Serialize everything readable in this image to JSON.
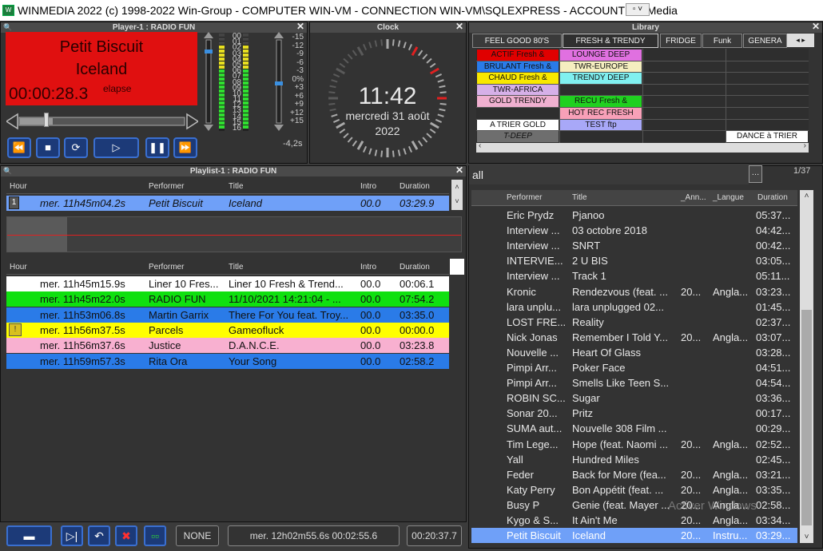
{
  "window": {
    "title": "WINMEDIA 2022 (c) 1998-2022 Win-Group - COMPUTER WIN-VM - CONNECTION WIN-VM\\SQLEXPRESS - ACCOUNT WinMedia"
  },
  "player": {
    "title": "Player-1 : RADIO FUN",
    "line1": "Petit Biscuit",
    "line2": "Iceland",
    "time": "00:00:28.3",
    "elapsed_label": "elapse",
    "scale_left": [
      "00",
      "01",
      "02",
      "03",
      "04",
      "05",
      "06",
      "07",
      "08",
      "09",
      "10",
      "11",
      "12",
      "13",
      "14",
      "15",
      "16"
    ],
    "scale_right": [
      "-15",
      "-12",
      "-9",
      "-6",
      "-3",
      "0%",
      "+3",
      "+6",
      "+9",
      "+12",
      "+15"
    ],
    "gain": "-4,2s",
    "progress": 0.2
  },
  "clock": {
    "title": "Clock",
    "time": "11:42",
    "date": "mercredi 31 août",
    "year": "2022"
  },
  "library": {
    "title": "Library",
    "tabs": [
      "FEEL GOOD 80'S",
      "FRESH & TRENDY",
      "FRIDGE",
      "Funk",
      "GENERA"
    ],
    "cells": [
      {
        "text": "ACTIF Fresh &",
        "color": "#e00000"
      },
      {
        "text": "LOUNGE DEEP",
        "color": "#e070e0"
      },
      {
        "text": "BRULANT Fresh &",
        "color": "#2a7be8"
      },
      {
        "text": "TWR-EUROPE",
        "color": "#f5eec0"
      },
      {
        "text": "CHAUD Fresh &",
        "color": "#f8e800"
      },
      {
        "text": "TRENDY DEEP",
        "color": "#80f0f0"
      },
      {
        "text": "TWR-AFRICA",
        "color": "#d6b0e8"
      },
      {
        "text": "GOLD TRENDY",
        "color": "#f0b0d0"
      },
      {
        "text": "RECU Fresh &",
        "color": "#20d020"
      },
      {
        "text": "HOT REC  FRESH",
        "color": "#f8a0b8"
      },
      {
        "text": "A TRIER GOLD",
        "color": "#ffffff"
      },
      {
        "text": "TEST ftp",
        "color": "#a8a8f8"
      },
      {
        "text": "T-DEEP",
        "color": "#6e6e6e"
      },
      {
        "text": "DANCE à TRIER",
        "color": "#ffffff"
      }
    ],
    "search": "all",
    "page": "1/37",
    "headers": [
      "Performer",
      "Title",
      "_Ann...",
      "_Langue",
      "Duration"
    ],
    "rows": [
      {
        "performer": "Eric Prydz",
        "title": "Pjanoo",
        "year": "",
        "lang": "",
        "duration": "05:37..."
      },
      {
        "performer": "Interview ...",
        "title": "03 octobre 2018",
        "year": "",
        "lang": "",
        "duration": "04:42..."
      },
      {
        "performer": "Interview ...",
        "title": "SNRT",
        "year": "",
        "lang": "",
        "duration": "00:42..."
      },
      {
        "performer": "INTERVIE...",
        "title": "2 U BIS",
        "year": "",
        "lang": "",
        "duration": "03:05..."
      },
      {
        "performer": "Interview ...",
        "title": "Track 1",
        "year": "",
        "lang": "",
        "duration": "05:11..."
      },
      {
        "performer": "Kronic",
        "title": "Rendezvous (feat. ...",
        "year": "20...",
        "lang": "Angla...",
        "duration": "03:23..."
      },
      {
        "performer": "lara unplu...",
        "title": "lara unplugged 02...",
        "year": "",
        "lang": "",
        "duration": "01:45..."
      },
      {
        "performer": "LOST FRE...",
        "title": "Reality",
        "year": "",
        "lang": "",
        "duration": "02:37..."
      },
      {
        "performer": "Nick Jonas",
        "title": "Remember I Told Y...",
        "year": "20...",
        "lang": "Angla...",
        "duration": "03:07..."
      },
      {
        "performer": "Nouvelle ...",
        "title": "Heart Of Glass",
        "year": "",
        "lang": "",
        "duration": "03:28..."
      },
      {
        "performer": "Pimpi Arr...",
        "title": "Poker Face",
        "year": "",
        "lang": "",
        "duration": "04:51..."
      },
      {
        "performer": "Pimpi Arr...",
        "title": "Smells Like Teen S...",
        "year": "",
        "lang": "",
        "duration": "04:54..."
      },
      {
        "performer": "ROBIN SC...",
        "title": "Sugar",
        "year": "",
        "lang": "",
        "duration": "03:36..."
      },
      {
        "performer": "Sonar 20...",
        "title": "Pritz",
        "year": "",
        "lang": "",
        "duration": "00:17..."
      },
      {
        "performer": "SUMA aut...",
        "title": "Nouvelle 308 Film ...",
        "year": "",
        "lang": "",
        "duration": "00:29..."
      },
      {
        "performer": "Tim Lege...",
        "title": "Hope (feat. Naomi ...",
        "year": "20...",
        "lang": "Angla...",
        "duration": "02:52..."
      },
      {
        "performer": "Yall",
        "title": "Hundred Miles",
        "year": "",
        "lang": "",
        "duration": "02:45..."
      },
      {
        "performer": "Feder",
        "title": "Back for More (fea...",
        "year": "20...",
        "lang": "Angla...",
        "duration": "03:21..."
      },
      {
        "performer": "Katy Perry",
        "title": "Bon Appétit (feat. ...",
        "year": "20...",
        "lang": "Angla...",
        "duration": "03:35..."
      },
      {
        "performer": "Busy P",
        "title": "Genie (feat. Mayer ...",
        "year": "20...",
        "lang": "Angla...",
        "duration": "02:58..."
      },
      {
        "performer": "Kygo & S...",
        "title": "It Ain't Me",
        "year": "20...",
        "lang": "Angla...",
        "duration": "03:34..."
      },
      {
        "performer": "Petit Biscuit",
        "title": "Iceland",
        "year": "20...",
        "lang": "Instru...",
        "duration": "03:29..."
      }
    ],
    "watermark": "Activer Windows"
  },
  "playlist": {
    "title": "Playlist-1 : RADIO FUN",
    "headers": [
      "Hour",
      "Performer",
      "Title",
      "Intro",
      "Duration"
    ],
    "current": {
      "index": "1",
      "hour": "mer. 11h45m04.2s",
      "performer": "Petit Biscuit",
      "title": "Iceland",
      "intro": "00.0",
      "duration": "03:29.9"
    },
    "rows": [
      {
        "hour": "mer. 11h45m15.9s",
        "performer": "Liner 10 Fres...",
        "title": "Liner 10 Fresh & Trend...",
        "intro": "00.0",
        "duration": "00:06.1",
        "bg": "#ffffff",
        "fg": "#111"
      },
      {
        "hour": "mer. 11h45m22.0s",
        "performer": "RADIO FUN",
        "title": "11/10/2021 14:21:04 - ...",
        "intro": "00.0",
        "duration": "07:54.2",
        "bg": "#10e010",
        "fg": "#111"
      },
      {
        "hour": "mer. 11h53m06.8s",
        "performer": "Martin Garrix",
        "title": "There For You feat. Troy...",
        "intro": "00.0",
        "duration": "03:35.0",
        "bg": "#2a7be8",
        "fg": "#111"
      },
      {
        "hour": "mer. 11h56m37.5s",
        "performer": "Parcels",
        "title": "Gameofluck",
        "intro": "00.0",
        "duration": "00:00.0",
        "bg": "#ffff00",
        "fg": "#111"
      },
      {
        "hour": "mer. 11h56m37.6s",
        "performer": "Justice",
        "title": "D.A.N.C.E.",
        "intro": "00.0",
        "duration": "03:23.8",
        "bg": "#f8b0d0",
        "fg": "#111"
      },
      {
        "hour": "mer. 11h59m57.3s",
        "performer": "Rita Ora",
        "title": "Your Song",
        "intro": "00.0",
        "duration": "02:58.2",
        "bg": "#2a7be8",
        "fg": "#111"
      }
    ]
  },
  "bottom": {
    "mode": "NONE",
    "next": "mer. 12h02m55.6s 00:02:55.6",
    "total": "00:20:37.7"
  }
}
